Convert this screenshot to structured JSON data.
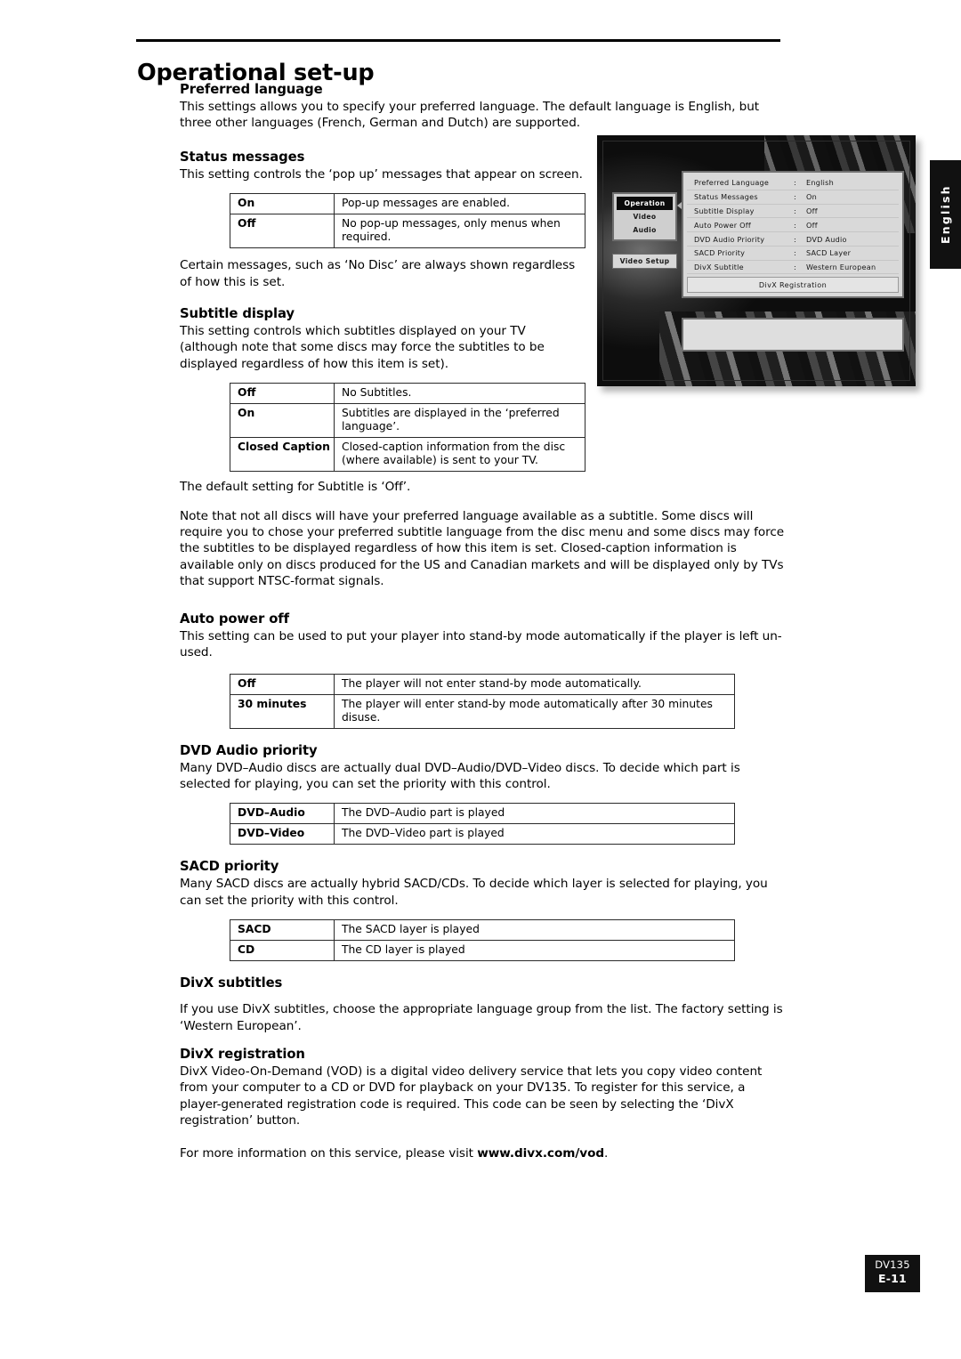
{
  "page": {
    "title": "Operational set-up",
    "language_tab": "English",
    "footer": {
      "model": "DV135",
      "page_number": "E-11"
    }
  },
  "sections": [
    {
      "heading": "Preferred language",
      "paragraphs": [
        "This settings allows you to specify your preferred language. The default language is English, but three other languages (French, German and Dutch) are supported."
      ]
    },
    {
      "heading": "Status messages",
      "paragraphs": [
        "This setting controls the ‘pop up’ messages that appear on screen."
      ],
      "after_table_paragraph": "Certain messages, such as ‘No Disc’ are always shown regardless of how this is set.",
      "table": [
        {
          "option": "On",
          "description": "Pop-up messages are enabled."
        },
        {
          "option": "Off",
          "description": "No pop-up messages, only menus when required."
        }
      ]
    },
    {
      "heading": "Subtitle display",
      "paragraphs": [
        "This setting controls which subtitles displayed on your TV (although note that some discs may force the subtitles to be displayed regardless of how this item is set)."
      ],
      "table": [
        {
          "option": "Off",
          "description": "No Subtitles."
        },
        {
          "option": "On",
          "description": "Subtitles are displayed in the ‘preferred language’."
        },
        {
          "option": "Closed Caption",
          "description": "Closed-caption information from the disc (where available) is sent to your TV."
        }
      ],
      "after_table_paragraph": "The default setting for Subtitle is ‘Off’.",
      "note_paragraph": "Note that not all discs will have your preferred language available as a subtitle. Some discs will require you to chose your preferred subtitle language from the disc menu and some discs may force the subtitles to be displayed regardless of how this item is set. Closed-caption information is available only on discs produced for the US and Canadian markets and will be displayed only by TVs that support NTSC-format signals."
    },
    {
      "heading": "Auto power off",
      "paragraphs": [
        "This setting can be used to put your player into stand-by mode automatically if the player is left un-used."
      ],
      "table": [
        {
          "option": "Off",
          "description": "The player will not enter stand-by mode automatically."
        },
        {
          "option": "30 minutes",
          "description": "The player will enter stand-by mode automatically after 30 minutes disuse."
        }
      ]
    },
    {
      "heading": "DVD Audio priority",
      "paragraphs": [
        "Many DVD–Audio discs are actually dual DVD–Audio/DVD–Video discs. To decide which part is selected for playing, you can set the priority with this control."
      ],
      "table": [
        {
          "option": "DVD–Audio",
          "description": "The DVD–Audio part is played"
        },
        {
          "option": "DVD–Video",
          "description": "The DVD–Video part is played"
        }
      ]
    },
    {
      "heading": "SACD priority",
      "paragraphs": [
        "Many SACD discs are actually hybrid SACD/CDs. To decide which layer is selected for playing, you can set the priority with this control."
      ],
      "table": [
        {
          "option": "SACD",
          "description": "The SACD layer is played"
        },
        {
          "option": "CD",
          "description": "The CD layer is played"
        }
      ]
    },
    {
      "heading": "DivX subtitles",
      "paragraphs": [
        "If you use DivX subtitles, choose the appropriate language group from the list. The factory setting is ‘Western European’."
      ]
    },
    {
      "heading": "DivX registration",
      "paragraphs": [
        "DivX Video-On-Demand (VOD) is a digital video delivery service that lets you copy video content from your computer to a CD or DVD for playback on your DV135. To register for this service, a player-generated registration code is required. This code can be seen by selecting the ‘DivX registration’ button."
      ],
      "footer_line_prefix": "For more information on this service, please visit ",
      "footer_link": "www.divx.com/vod",
      "footer_line_suffix": "."
    }
  ],
  "osd": {
    "nav": [
      {
        "label": "Operation",
        "selected": true
      },
      {
        "label": "Video",
        "selected": false
      },
      {
        "label": "Audio",
        "selected": false
      }
    ],
    "video_setup_button": "Video Setup",
    "settings": [
      {
        "label": "Preferred Language",
        "colon": ":",
        "value": "English"
      },
      {
        "label": "Status Messages",
        "colon": ":",
        "value": "On"
      },
      {
        "label": "Subtitle Display",
        "colon": ":",
        "value": "Off"
      },
      {
        "label": "Auto Power Off",
        "colon": ":",
        "value": "Off"
      },
      {
        "label": "DVD Audio Priority",
        "colon": ":",
        "value": "DVD Audio"
      },
      {
        "label": "SACD Priority",
        "colon": ":",
        "value": "SACD Layer"
      },
      {
        "label": "DivX Subtitle",
        "colon": ":",
        "value": "Western European"
      }
    ],
    "registration_button": "DivX Registration"
  }
}
